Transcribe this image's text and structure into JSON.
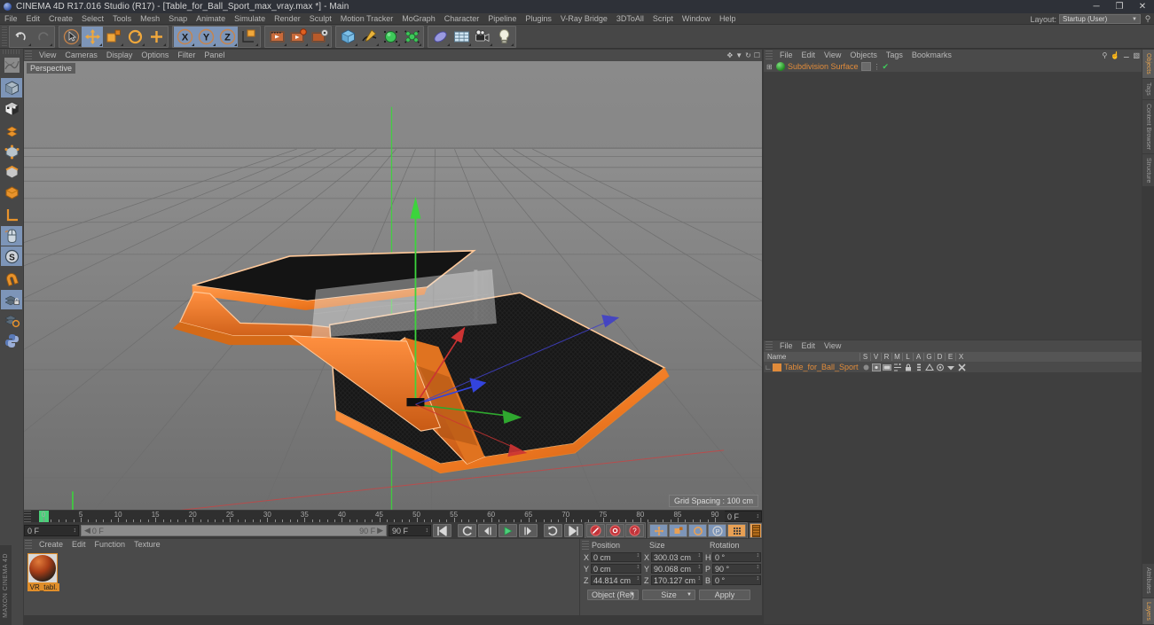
{
  "window": {
    "title": "CINEMA 4D R17.016 Studio (R17) - [Table_for_Ball_Sport_max_vray.max *] - Main",
    "app_icon": "c4d-logo-icon",
    "minimize": "─",
    "maximize": "❐",
    "close": "✕"
  },
  "menubar": {
    "items": [
      "File",
      "Edit",
      "Create",
      "Select",
      "Tools",
      "Mesh",
      "Snap",
      "Animate",
      "Simulate",
      "Render",
      "Sculpt",
      "Motion Tracker",
      "MoGraph",
      "Character",
      "Pipeline",
      "Plugins",
      "V-Ray Bridge",
      "3DToAll",
      "Script",
      "Window",
      "Help"
    ],
    "layout_label": "Layout:",
    "layout_value": "Startup (User)",
    "search_icon": "magnifier-icon"
  },
  "toolbar": {
    "groups": [
      {
        "name": "undo-redo",
        "buttons": [
          {
            "icon": "undo-icon",
            "label": "Undo",
            "selected": false
          },
          {
            "icon": "redo-icon",
            "label": "Redo",
            "selected": false
          }
        ]
      },
      {
        "name": "transform-tools",
        "buttons": [
          {
            "icon": "live-selection-icon",
            "label": "Live Selection",
            "selected": false
          },
          {
            "icon": "move-icon",
            "label": "Move",
            "selected": true
          },
          {
            "icon": "scale-icon",
            "label": "Scale",
            "selected": false
          },
          {
            "icon": "rotate-icon",
            "label": "Rotate",
            "selected": false
          },
          {
            "icon": "move-plus-icon",
            "label": "Move Tool",
            "selected": false
          }
        ]
      },
      {
        "name": "axis-locks",
        "buttons": [
          {
            "icon": "x-axis-icon",
            "label": "X",
            "selected": true
          },
          {
            "icon": "y-axis-icon",
            "label": "Y",
            "selected": true
          },
          {
            "icon": "z-axis-icon",
            "label": "Z",
            "selected": true
          },
          {
            "icon": "world-object-axis-icon",
            "label": "World/Object",
            "selected": false
          }
        ]
      },
      {
        "name": "render-tools",
        "buttons": [
          {
            "icon": "render-view-icon",
            "label": "Render View",
            "selected": false
          },
          {
            "icon": "render-region-icon",
            "label": "Render to Picture Viewer",
            "selected": false
          },
          {
            "icon": "render-settings-icon",
            "label": "Render Settings",
            "selected": false
          }
        ]
      },
      {
        "name": "object-creation",
        "buttons": [
          {
            "icon": "cube-primitive-icon",
            "label": "Add Cube Object",
            "selected": false
          },
          {
            "icon": "spline-pen-icon",
            "label": "Add Spline",
            "selected": false
          },
          {
            "icon": "nurbs-icon",
            "label": "Add Generator Object",
            "selected": false
          },
          {
            "icon": "array-deformer-icon",
            "label": "Add Deformer Object",
            "selected": false
          }
        ]
      },
      {
        "name": "scene-objects",
        "buttons": [
          {
            "icon": "environment-icon",
            "label": "Add Scene Object",
            "selected": false
          },
          {
            "icon": "floor-icon",
            "label": "Add Physical Sky",
            "selected": false
          },
          {
            "icon": "camera-icon",
            "label": "Add Camera",
            "selected": false
          },
          {
            "icon": "light-icon",
            "label": "Add Light",
            "selected": false
          }
        ]
      }
    ]
  },
  "left_palette": {
    "items": [
      {
        "icon": "texture-axis-icon",
        "label": "Texture Axis",
        "selected": false
      },
      {
        "icon": "model-mode-icon",
        "label": "Model Mode",
        "selected": true
      },
      {
        "icon": "object-mode-icon",
        "label": "Object Mode",
        "selected": false
      },
      {
        "icon": "polygon-mode-icon",
        "label": "Polygon Mode",
        "selected": false
      },
      {
        "icon": "points-mode-icon",
        "label": "Points Mode",
        "selected": false
      },
      {
        "icon": "edges-mode-icon",
        "label": "Edges Mode",
        "selected": false
      },
      {
        "icon": "texture-mode-icon",
        "label": "Texture Mode",
        "selected": false
      },
      {
        "icon": "axis-mode-icon",
        "label": "Enable Axis",
        "selected": false
      },
      {
        "icon": "viewport-solo-icon",
        "label": "Viewport Solo",
        "selected": true
      },
      {
        "icon": "s-snap-icon",
        "label": "Enable Snap",
        "selected": true
      },
      {
        "icon": "magnet-icon",
        "label": "Magnet",
        "selected": false
      },
      {
        "icon": "workplane-lock-icon",
        "label": "Lock Workplane",
        "selected": true
      },
      {
        "icon": "workplane-rotate-icon",
        "label": "Rotate Workplane",
        "selected": false
      },
      {
        "icon": "python-icon",
        "label": "Python Script",
        "selected": false
      }
    ]
  },
  "viewport": {
    "menu": [
      "View",
      "Cameras",
      "Display",
      "Options",
      "Filter",
      "Panel"
    ],
    "corner_icons": [
      "pan-icon",
      "zoom-icon",
      "rotate-icon",
      "maximize-icon"
    ],
    "label": "Perspective",
    "grid_spacing": "Grid Spacing : 100 cm",
    "background_color": "#7a7a7a",
    "model": {
      "name": "Table for Ball Sport",
      "body_color": "#f07a22",
      "top_color": "#1a1a1a",
      "highlight_color": "#ffc99a",
      "net_color": "#d8d8d8"
    },
    "axis_gizmo": {
      "x_color": "#e03c3c",
      "y_color": "#3cd43c",
      "z_color": "#3c4ce0"
    }
  },
  "timeline": {
    "marks": [
      0,
      5,
      10,
      15,
      20,
      25,
      30,
      35,
      40,
      45,
      50,
      55,
      60,
      65,
      70,
      75,
      80,
      85,
      90
    ],
    "range_start": 0,
    "range_end": 90,
    "current_frame": "0 F",
    "start_field": "0 F",
    "end_field": "90 F",
    "preview_start": "0 F",
    "preview_end": "90 F",
    "frame_box": "0 F",
    "playhead_frame": 0,
    "buttons": [
      {
        "icon": "go-to-start-icon",
        "label": "Go to Start"
      },
      {
        "icon": "play-reverse-icon",
        "label": "Play Reverse"
      },
      {
        "icon": "previous-frame-icon",
        "label": "Go to Previous Frame"
      },
      {
        "icon": "play-forward-icon",
        "label": "Play Forward"
      },
      {
        "icon": "next-frame-icon",
        "label": "Go to Next Frame"
      },
      {
        "icon": "loop-icon",
        "label": "Loop"
      },
      {
        "icon": "go-to-end-icon",
        "label": "Go to End"
      }
    ],
    "record_buttons": [
      {
        "icon": "record-keyframe-icon",
        "label": "Record Active Objects"
      },
      {
        "icon": "autokey-icon",
        "label": "Autokeying"
      },
      {
        "icon": "keyframe-selection-icon",
        "label": "Keyframe Selection"
      }
    ],
    "key_toggles": [
      {
        "icon": "position-key-icon",
        "label": "Position"
      },
      {
        "icon": "scale-key-icon",
        "label": "Scale"
      },
      {
        "icon": "rotation-key-icon",
        "label": "Rotation"
      },
      {
        "icon": "parameter-key-icon",
        "label": "Parameter"
      },
      {
        "icon": "point-level-anim-icon",
        "label": "Point Level Animation"
      }
    ]
  },
  "materials": {
    "menu": [
      "Create",
      "Edit",
      "Function",
      "Texture"
    ],
    "items": [
      {
        "name": "VR_tabl.",
        "preview": "material-sphere-preview",
        "selected": true
      }
    ]
  },
  "coordinates": {
    "headers": [
      "Position",
      "Size",
      "Rotation"
    ],
    "position": {
      "labels": [
        "X",
        "Y",
        "Z"
      ],
      "values": [
        "0 cm",
        "0 cm",
        "44.814 cm"
      ]
    },
    "size": {
      "labels": [
        "X",
        "Y",
        "Z"
      ],
      "values": [
        "300.03 cm",
        "90.068 cm",
        "170.127 cm"
      ]
    },
    "rotation": {
      "labels": [
        "H",
        "P",
        "B"
      ],
      "values": [
        "0 °",
        "90 °",
        "0 °"
      ]
    },
    "mode_select": "Object (Rel)",
    "size_select": "Size",
    "apply_button": "Apply"
  },
  "object_manager": {
    "menu": [
      "File",
      "Edit",
      "View",
      "Objects",
      "Tags",
      "Bookmarks"
    ],
    "corner_icons": [
      "search-icon",
      "home-icon",
      "minimize-icon",
      "layout-icon"
    ],
    "objects": [
      {
        "name": "Subdivision Surface",
        "expander": "⊞",
        "icon": "subdivision-surface-icon",
        "tags": [
          "phong-tag",
          "visibility-dots",
          "green-check-tag"
        ]
      }
    ]
  },
  "layer_manager": {
    "menu": [
      "File",
      "Edit",
      "View"
    ],
    "columns": [
      "Name",
      "S",
      "V",
      "R",
      "M",
      "L",
      "A",
      "G",
      "D",
      "E",
      "X"
    ],
    "rows": [
      {
        "name": "Table_for_Ball_Sport",
        "color": "#f07a22",
        "icons": [
          "solo-dot-icon",
          "view-icon",
          "render-icon",
          "manager-icon",
          "lock-icon",
          "animation-icon",
          "generator-icon",
          "deformer-icon",
          "expression-icon",
          "xref-icon"
        ]
      }
    ]
  },
  "right_tabs": {
    "items": [
      {
        "label": "Objects",
        "active": true
      },
      {
        "label": "Tags",
        "active": false
      },
      {
        "label": "Content Browser",
        "active": false
      },
      {
        "label": "Structure",
        "active": false
      },
      {
        "label": "Attributes",
        "active": false
      },
      {
        "label": "Layers",
        "active": true
      }
    ]
  },
  "brand": {
    "text": "MAXON CINEMA 4D"
  }
}
